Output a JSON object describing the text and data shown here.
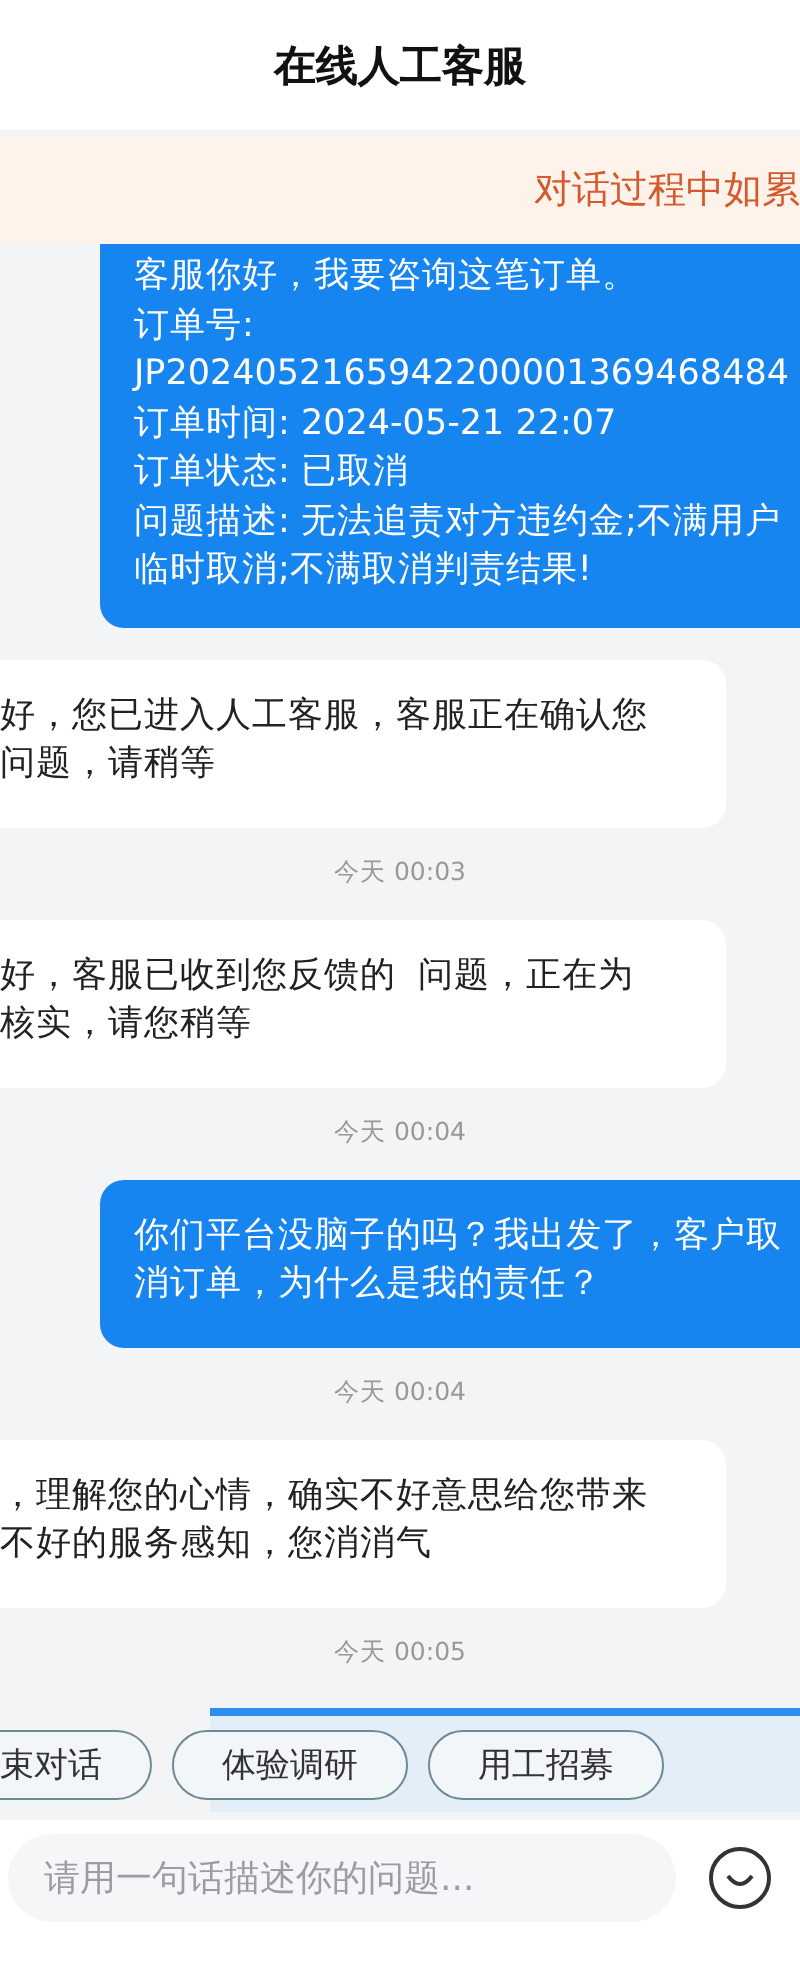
{
  "header": {
    "title": "在线人工客服"
  },
  "notice": {
    "text": "对话过程中如累"
  },
  "messages": [
    {
      "kind": "user",
      "lines": [
        "客服你好，我要咨询这笔订单。",
        "订单号: JP2024052165942200001369468484",
        "订单时间: 2024-05-21 22:07",
        "订单状态: 已取消",
        "问题描述: 无法追责对方违约金;不满用户临时取消;不满取消判责结果!"
      ]
    },
    {
      "kind": "agent",
      "lines": [
        "好，您已进入人工客服，客服正在确认您问题，请稍等"
      ]
    },
    {
      "kind": "time",
      "text": "今天 00:03"
    },
    {
      "kind": "agent",
      "lines": [
        "好，客服已收到您反馈的  问题，正在为核实，请您稍等"
      ]
    },
    {
      "kind": "time",
      "text": "今天 00:04"
    },
    {
      "kind": "user",
      "lines": [
        "你们平台没脑子的吗？我出发了，客户取消订单，为什么是我的责任？"
      ]
    },
    {
      "kind": "time",
      "text": "今天 00:04"
    },
    {
      "kind": "agent",
      "lines": [
        "，理解您的心情，确实不好意思给您带来不好的服务感知，您消消气"
      ]
    },
    {
      "kind": "time",
      "text": "今天 00:05"
    }
  ],
  "quick_replies": [
    "束对话",
    "体验调研",
    "用工招募"
  ],
  "input": {
    "placeholder": "请用一句话描述你的问题..."
  }
}
